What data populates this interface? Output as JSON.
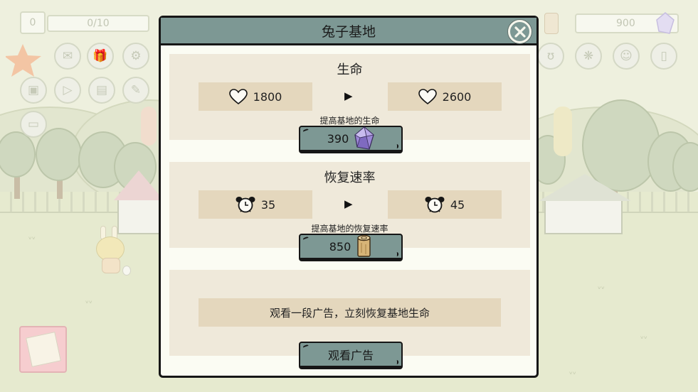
{
  "hud": {
    "count_badge": "0",
    "count_progress": "0/10",
    "gem_total": "900"
  },
  "dialog": {
    "title": "兔子基地",
    "life": {
      "title": "生命",
      "current_value": "1800",
      "next_value": "2600",
      "upgrade_hint": "提高基地的生命",
      "upgrade_cost": "390",
      "cost_icon": "purple-gem-icon"
    },
    "recovery": {
      "title": "恢复速率",
      "current_value": "35",
      "next_value": "45",
      "upgrade_hint": "提高基地的恢复速率",
      "upgrade_cost": "850",
      "cost_icon": "wood-log-icon"
    },
    "ad": {
      "description": "观看一段广告，立刻恢复基地生命",
      "button_label": "观看广告"
    }
  },
  "colors": {
    "header": "#7d9894",
    "panel": "#efe9da",
    "stat_box": "#e4d7bd",
    "gem": "#9b86d6"
  }
}
